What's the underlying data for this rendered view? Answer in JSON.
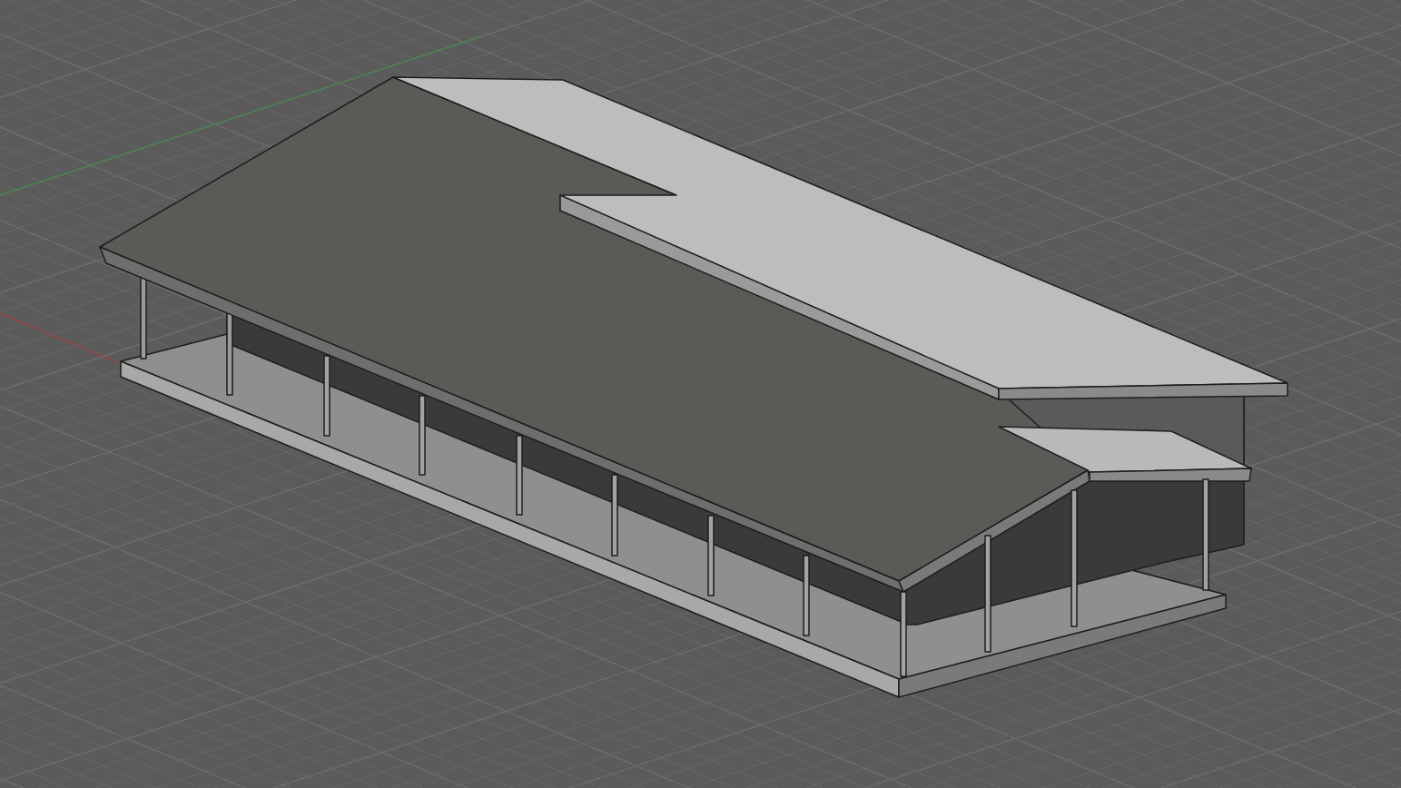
{
  "viewport": {
    "grid": true,
    "axes": true
  }
}
